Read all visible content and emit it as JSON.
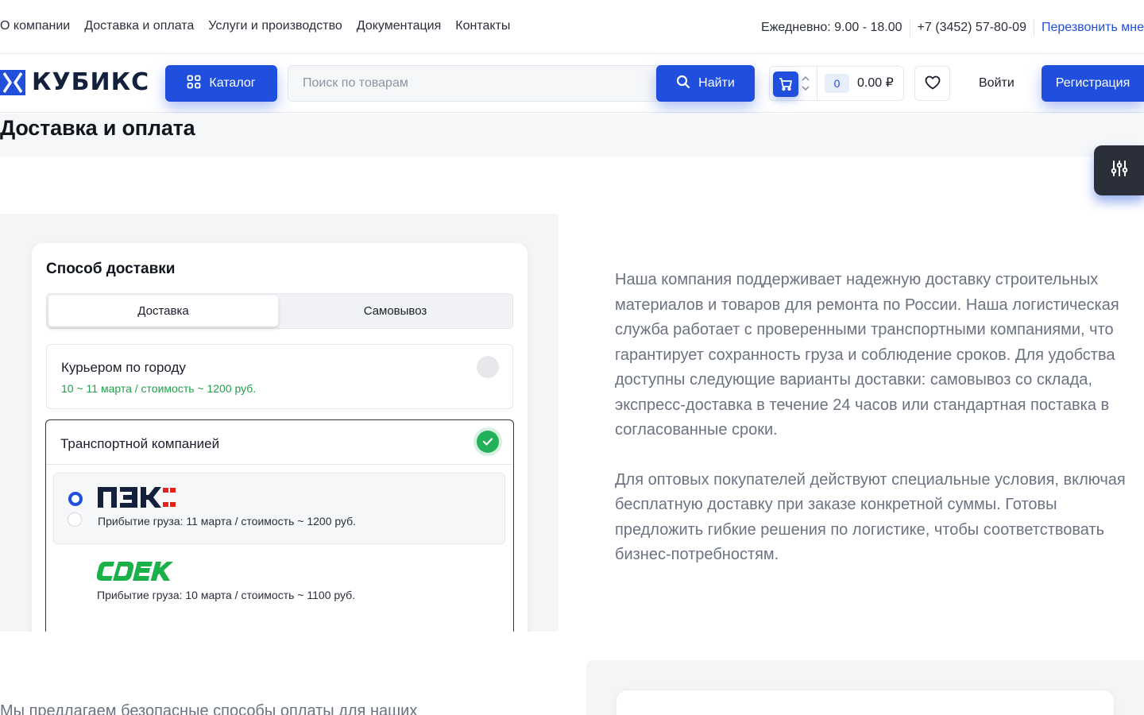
{
  "topnav": {
    "items": [
      "О компании",
      "Доставка и оплата",
      "Услуги и производство",
      "Документация",
      "Контакты"
    ],
    "hours": "Ежедневно: 9.00 - 18.00",
    "phone": "+7 (3452) 57-80-09",
    "callback": "Перезвонить мне"
  },
  "header": {
    "logo_text": "КУБИКС",
    "catalog_label": "Каталог",
    "search_placeholder": "Поиск по товарам",
    "search_value": "",
    "find_label": "Найти",
    "cart_count": "0",
    "cart_sum": "0.00 ₽",
    "login_label": "Войти",
    "register_label": "Регистрация"
  },
  "page": {
    "title": "Доставка и оплата"
  },
  "delivery": {
    "title": "Способ доставки",
    "tabs": [
      "Доставка",
      "Самовывоз"
    ],
    "active_tab": "Доставка",
    "courier": {
      "title": "Курьером по городу",
      "subtitle": "10 ~ 11 марта / стоимость ~ 1200 руб."
    },
    "transport": {
      "title": "Транспортной компанией",
      "carriers": [
        {
          "name": "ПЭК",
          "subtitle": "Прибытие груза: 11 марта / стоимость ~ 1200 руб.",
          "selected": true
        },
        {
          "name": "CDEK",
          "subtitle": "Прибытие груза: 10 марта / стоимость ~ 1100 руб.",
          "selected": false
        }
      ]
    }
  },
  "info": {
    "paragraph1": "Наша компания поддерживает надежную доставку строительных материалов и товаров для ремонта по России. Наша логистическая служба работает с проверенными транспортными компаниями, что гарантирует сохранность груза и соблюдение сроков. Для удобства доступны следующие варианты доставки: самовывоз со склада, экспресс-доставка в течение 24 часов или стандартная поставка в согласованные сроки.",
    "paragraph2": "Для оптовых покупателей действуют специальные условия, включая бесплатную доставку при заказе конкретной суммы. Готовы предложить гибкие решения по логистике, чтобы соответствовать бизнес-потребностям."
  },
  "payment": {
    "intro": "Мы предлагаем безопасные способы оплаты для наших"
  },
  "colors": {
    "accent": "#1f4fdc",
    "success": "#22b05a",
    "pek_red": "#e2231a",
    "cdek_green": "#1ab248",
    "dark": "#14213d"
  }
}
